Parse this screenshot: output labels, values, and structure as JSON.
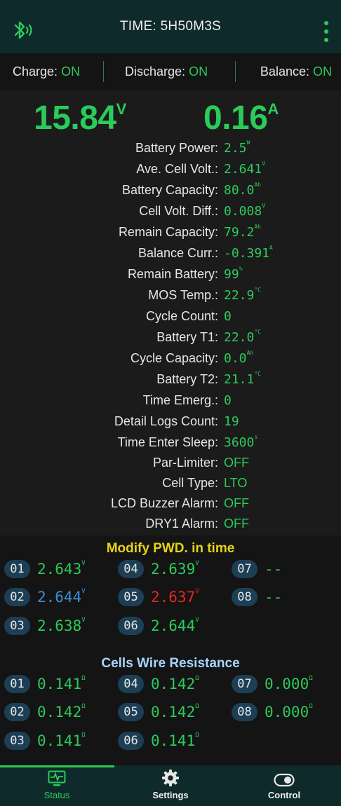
{
  "header": {
    "title": "TIME: 5H50M3S",
    "left_icon": "bluetooth-icon",
    "right_icon": "more-vert-icon"
  },
  "switches": [
    {
      "label": "Charge:",
      "value": "ON"
    },
    {
      "label": "Discharge:",
      "value": "ON"
    },
    {
      "label": "Balance:",
      "value": "ON"
    }
  ],
  "summary": {
    "voltage": "15.84",
    "voltage_unit": "V",
    "current": "0.16",
    "current_unit": "A"
  },
  "params": [
    {
      "label": "Battery Power:",
      "value": "2.5",
      "unit": "W"
    },
    {
      "label": "Ave. Cell Volt.:",
      "value": "2.641",
      "unit": "V"
    },
    {
      "label": "Battery Capacity:",
      "value": "80.0",
      "unit": "Ah"
    },
    {
      "label": "Cell Volt. Diff.:",
      "value": "0.008",
      "unit": "V"
    },
    {
      "label": "Remain Capacity:",
      "value": "79.2",
      "unit": "Ah"
    },
    {
      "label": "Balance Curr.:",
      "value": "-0.391",
      "unit": "A"
    },
    {
      "label": "Remain Battery:",
      "value": "99",
      "unit": "%"
    },
    {
      "label": "MOS Temp.:",
      "value": "22.9",
      "unit": "°C"
    },
    {
      "label": "Cycle Count:",
      "value": "0",
      "unit": ""
    },
    {
      "label": "Battery T1:",
      "value": "22.0",
      "unit": "°C"
    },
    {
      "label": "Cycle Capacity:",
      "value": "0.0",
      "unit": "Ah"
    },
    {
      "label": "Battery T2:",
      "value": "21.1",
      "unit": "°C"
    },
    {
      "label": "Time Emerg.:",
      "value": "0",
      "unit": ""
    },
    {
      "label": "Detail Logs Count:",
      "value": "19",
      "unit": ""
    },
    {
      "label": "Time Enter Sleep:",
      "value": "3600",
      "unit": "s"
    },
    {
      "label": "Par-Limiter:",
      "value": "OFF",
      "unit": ""
    },
    {
      "label": "Cell Type:",
      "value": "LTO",
      "unit": ""
    },
    {
      "label": "LCD Buzzer Alarm:",
      "value": "OFF",
      "unit": ""
    },
    {
      "label": "DRY1 Alarm:",
      "value": "OFF",
      "unit": ""
    }
  ],
  "voltages": {
    "title": "Modify PWD. in time",
    "cells": [
      {
        "id": "01",
        "value": "2.643",
        "unit": "V",
        "color": "#2bcb5a"
      },
      {
        "id": "02",
        "value": "2.644",
        "unit": "V",
        "color": "#3b8fd6"
      },
      {
        "id": "03",
        "value": "2.638",
        "unit": "V",
        "color": "#2bcb5a"
      },
      {
        "id": "04",
        "value": "2.639",
        "unit": "V",
        "color": "#2bcb5a"
      },
      {
        "id": "05",
        "value": "2.637",
        "unit": "V",
        "color": "#e8261f"
      },
      {
        "id": "06",
        "value": "2.644",
        "unit": "V",
        "color": "#2bcb5a"
      },
      {
        "id": "07",
        "value": "--",
        "unit": "",
        "color": "#2bcb5a"
      },
      {
        "id": "08",
        "value": "--",
        "unit": "",
        "color": "#2bcb5a"
      }
    ]
  },
  "resistance": {
    "title": "Cells Wire Resistance",
    "cells": [
      {
        "id": "01",
        "value": "0.141",
        "unit": "Ω",
        "color": "#2bcb5a"
      },
      {
        "id": "02",
        "value": "0.142",
        "unit": "Ω",
        "color": "#2bcb5a"
      },
      {
        "id": "03",
        "value": "0.141",
        "unit": "Ω",
        "color": "#2bcb5a"
      },
      {
        "id": "04",
        "value": "0.142",
        "unit": "Ω",
        "color": "#2bcb5a"
      },
      {
        "id": "05",
        "value": "0.142",
        "unit": "Ω",
        "color": "#2bcb5a"
      },
      {
        "id": "06",
        "value": "0.141",
        "unit": "Ω",
        "color": "#2bcb5a"
      },
      {
        "id": "07",
        "value": "0.000",
        "unit": "Ω",
        "color": "#2bcb5a"
      },
      {
        "id": "08",
        "value": "0.000",
        "unit": "Ω",
        "color": "#2bcb5a"
      }
    ]
  },
  "nav": [
    {
      "label": "Status",
      "icon": "monitor-icon",
      "active": true
    },
    {
      "label": "Settings",
      "icon": "gear-icon",
      "active": false
    },
    {
      "label": "Control",
      "icon": "toggle-icon",
      "active": false
    }
  ]
}
